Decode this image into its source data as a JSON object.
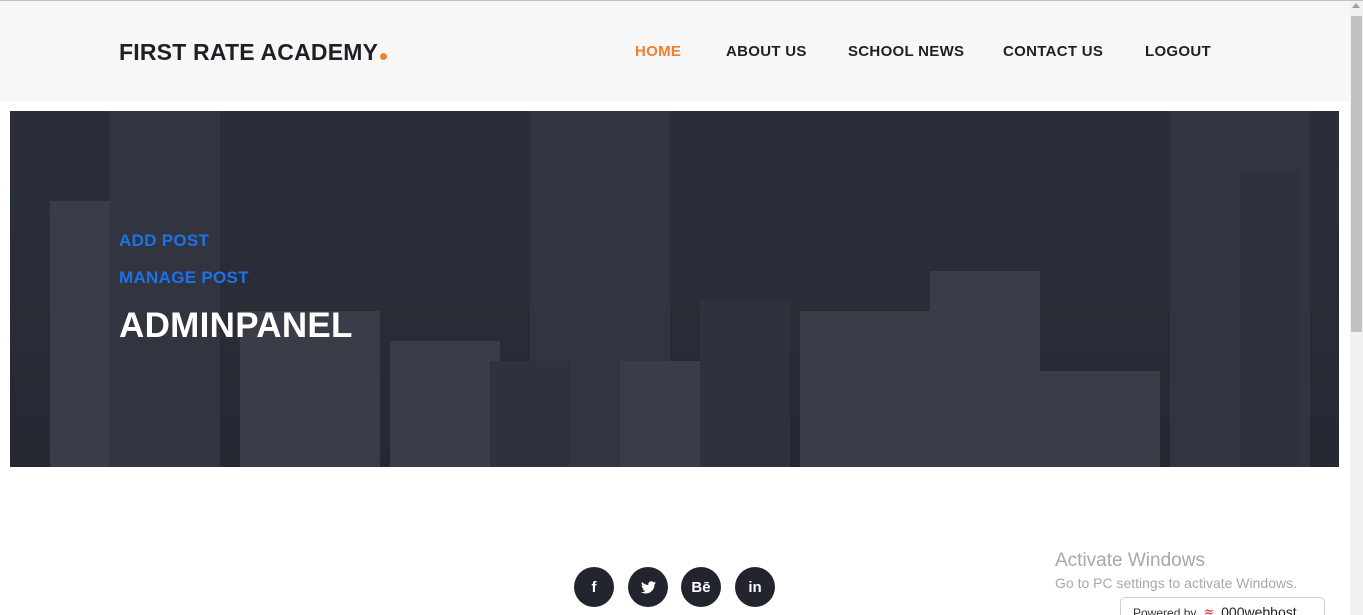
{
  "header": {
    "brand": "FIRST RATE ACADEMY",
    "nav": [
      {
        "label": "HOME",
        "active": true
      },
      {
        "label": "ABOUT US",
        "active": false
      },
      {
        "label": "SCHOOL NEWS",
        "active": false
      },
      {
        "label": "CONTACT US",
        "active": false
      },
      {
        "label": "LOGOUT",
        "active": false
      }
    ]
  },
  "hero": {
    "add_post": "ADD POST",
    "manage_post": "MANAGE POST",
    "title": "ADMINPANEL"
  },
  "footer": {
    "social": [
      {
        "icon": "facebook-icon",
        "glyph": "f"
      },
      {
        "icon": "twitter-icon",
        "glyph": "t"
      },
      {
        "icon": "behance-icon",
        "glyph": "Bē"
      },
      {
        "icon": "linkedin-icon",
        "glyph": "in"
      }
    ]
  },
  "overlay": {
    "activate_title": "Activate Windows",
    "activate_sub": "Go to PC settings to activate Windows.",
    "powered_by": "Powered by",
    "webhost": "000webhost"
  },
  "colors": {
    "accent": "#f0802d",
    "link_blue": "#1a73e8",
    "hero_bg": "#2a2d37",
    "nav_text": "#1f2027"
  }
}
